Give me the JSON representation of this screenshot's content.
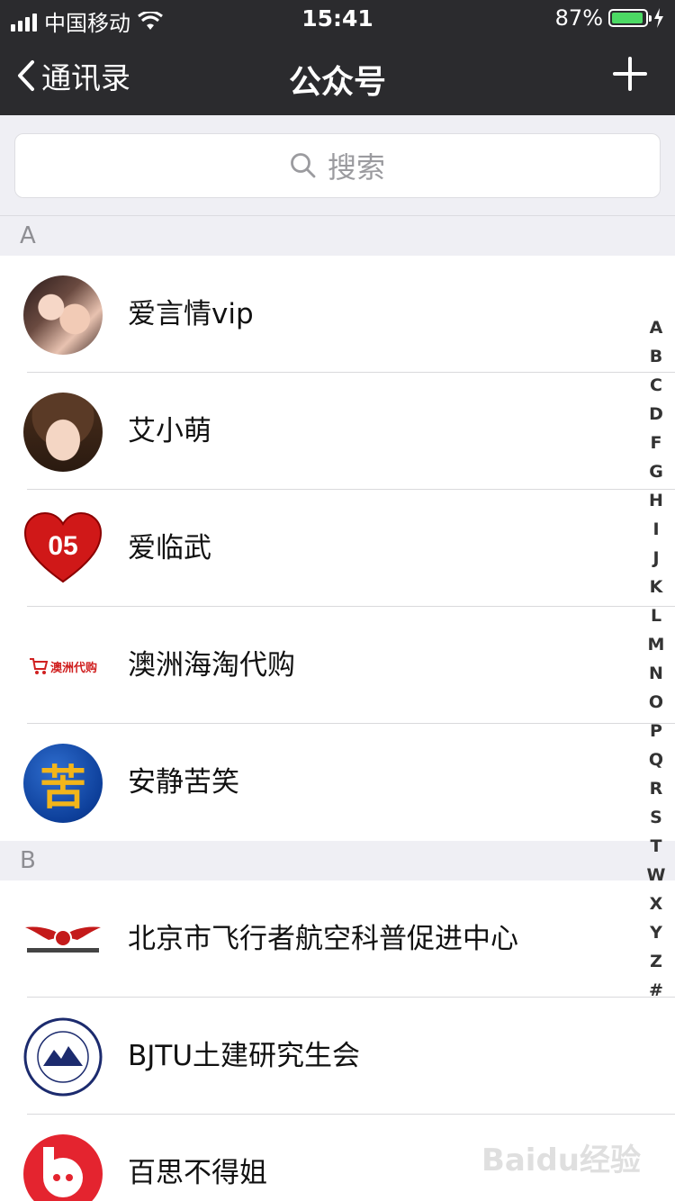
{
  "status_bar": {
    "carrier": "中国移动",
    "time": "15:41",
    "battery": "87%",
    "battery_level": 0.87
  },
  "nav": {
    "back_label": "通讯录",
    "title": "公众号"
  },
  "search": {
    "placeholder": "搜索"
  },
  "sections": [
    {
      "letter": "A",
      "items": [
        {
          "name": "爱言情vip"
        },
        {
          "name": "艾小萌"
        },
        {
          "name": "爱临武",
          "avatar_text": "05"
        },
        {
          "name": "澳洲海淘代购",
          "avatar_text": "澳洲代购"
        },
        {
          "name": "安静苦笑",
          "avatar_text": "苦"
        }
      ]
    },
    {
      "letter": "B",
      "items": [
        {
          "name": "北京市飞行者航空科普促进中心"
        },
        {
          "name": "BJTU土建研究生会"
        },
        {
          "name": "百思不得姐"
        }
      ]
    }
  ],
  "index_letters": [
    "A",
    "B",
    "C",
    "D",
    "F",
    "G",
    "H",
    "I",
    "J",
    "K",
    "L",
    "M",
    "N",
    "O",
    "P",
    "Q",
    "R",
    "S",
    "T",
    "W",
    "X",
    "Y",
    "Z",
    "#"
  ],
  "watermark": "Baidu经验",
  "colors": {
    "nav_bg": "#2b2b2e",
    "battery_green": "#4cd964",
    "section_bg": "#efeff4"
  }
}
